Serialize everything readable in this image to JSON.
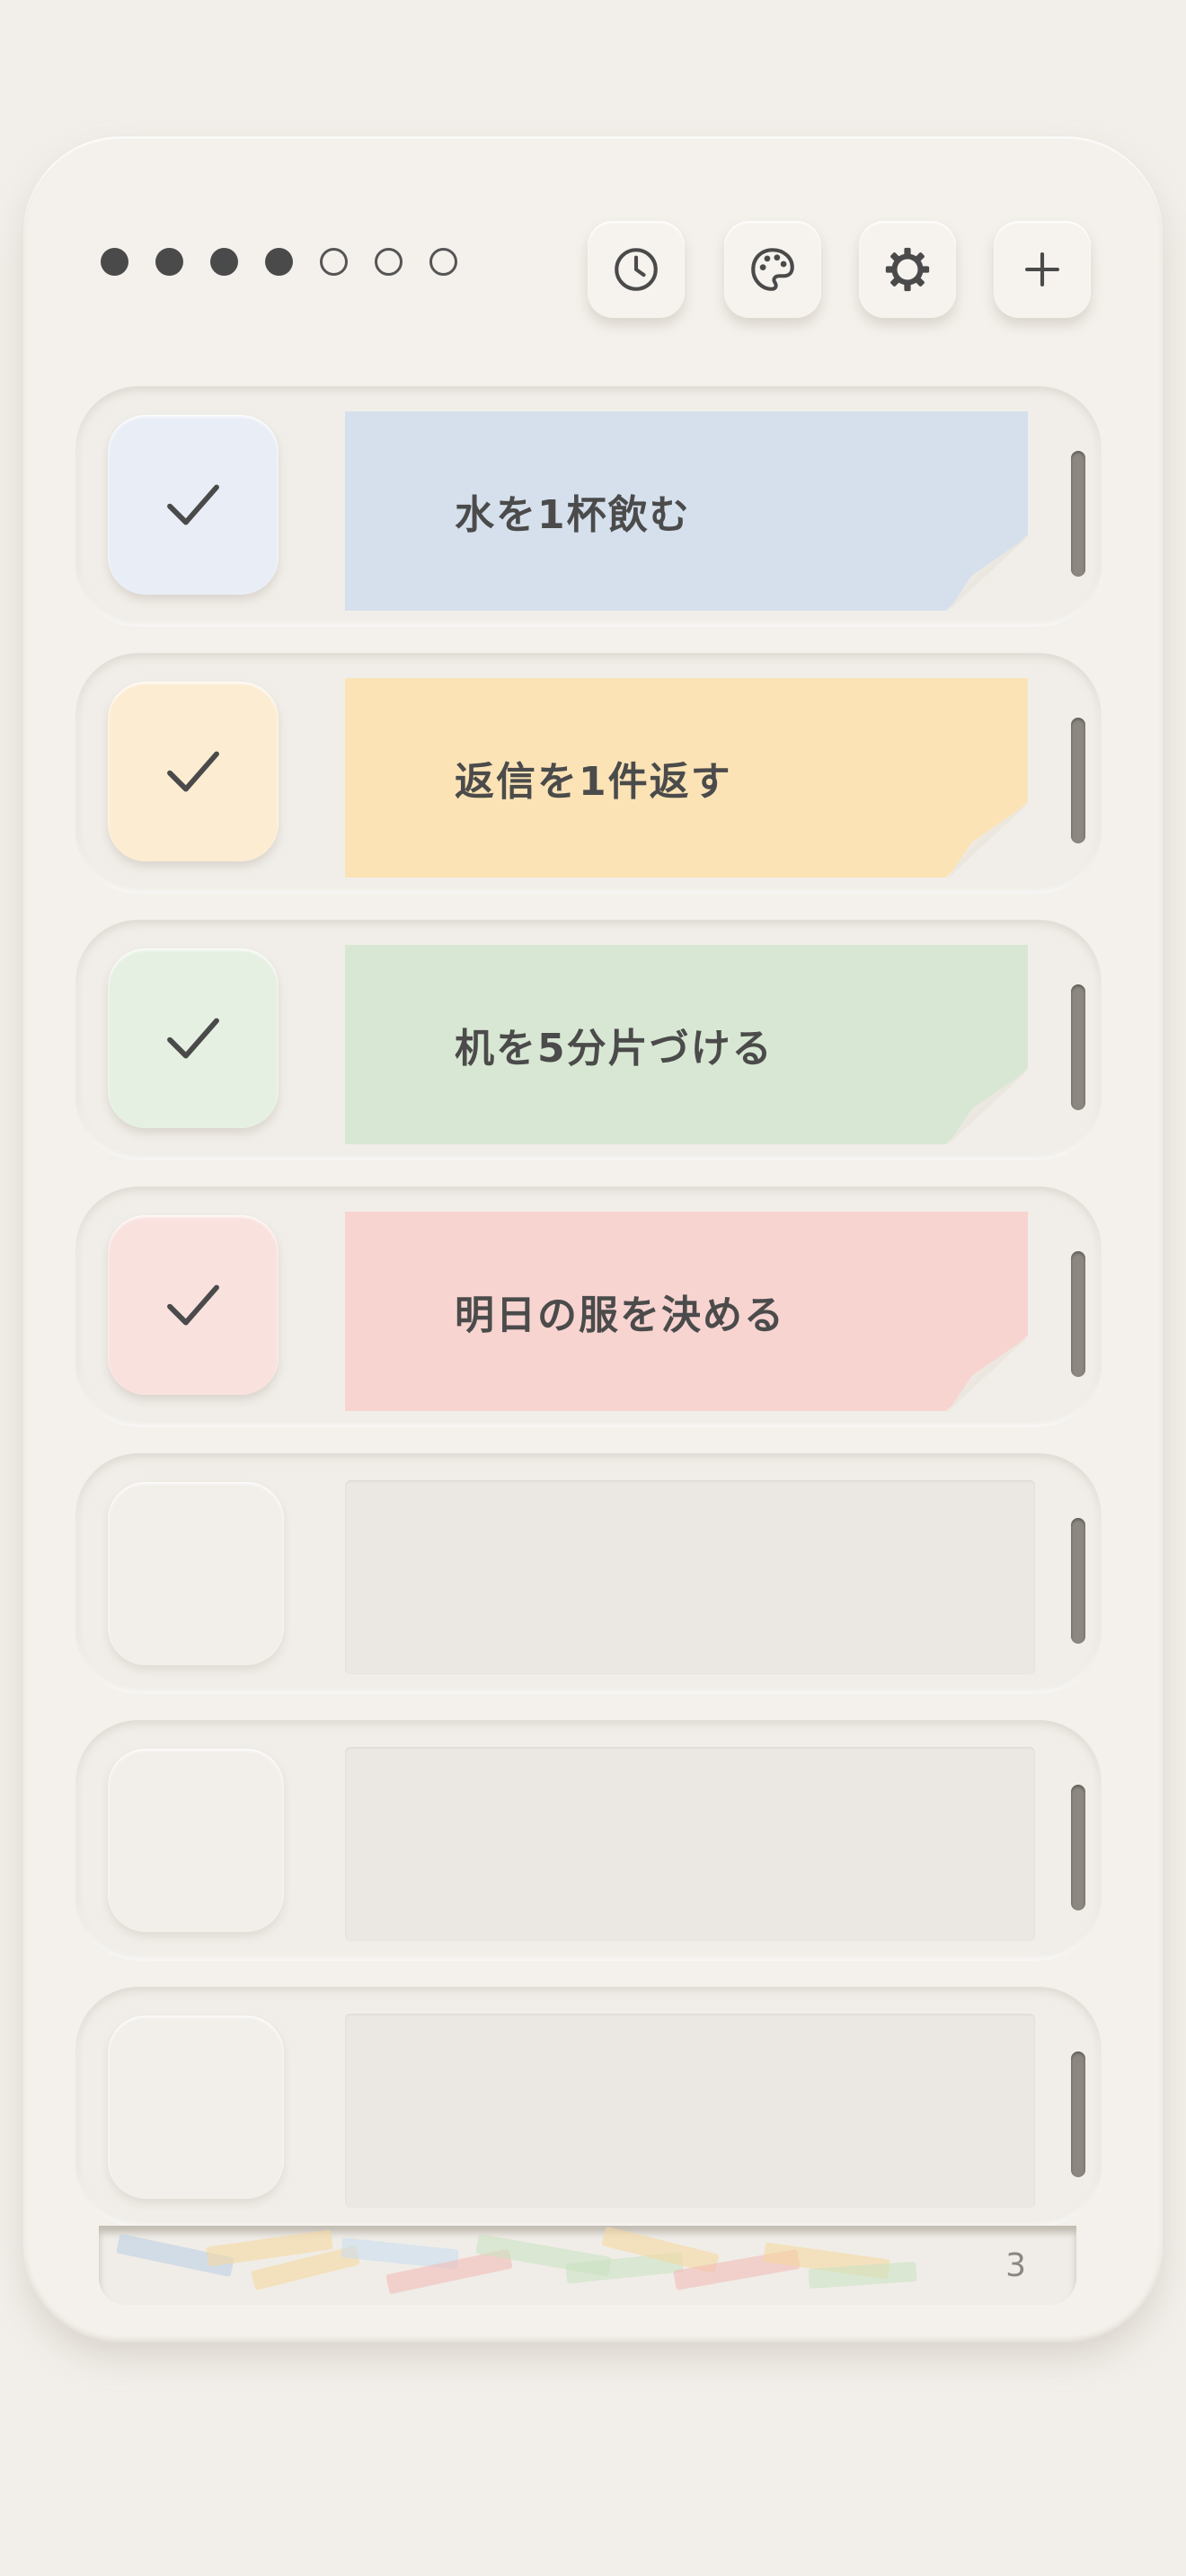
{
  "progress": {
    "completed": 4,
    "total": 7
  },
  "toolbar": [
    {
      "name": "history-button",
      "icon": "clock-icon"
    },
    {
      "name": "theme-button",
      "icon": "palette-icon"
    },
    {
      "name": "settings-button",
      "icon": "gear-icon"
    },
    {
      "name": "add-button",
      "icon": "plus-icon"
    }
  ],
  "tasks": [
    {
      "label": "水を1杯飲む",
      "done": true,
      "color": "#d5e0ec",
      "check_color": "#e9eef6"
    },
    {
      "label": "返信を1件返す",
      "done": true,
      "color": "#fbe3b6",
      "check_color": "#fcecd2"
    },
    {
      "label": "机を5分片づける",
      "done": true,
      "color": "#d8e7d3",
      "check_color": "#e6f0e2"
    },
    {
      "label": "明日の服を決める",
      "done": true,
      "color": "#f7d4d0",
      "check_color": "#f9e1de"
    },
    {
      "label": "",
      "done": false
    },
    {
      "label": "",
      "done": false
    },
    {
      "label": "",
      "done": false
    }
  ],
  "archive": {
    "count": "3"
  }
}
